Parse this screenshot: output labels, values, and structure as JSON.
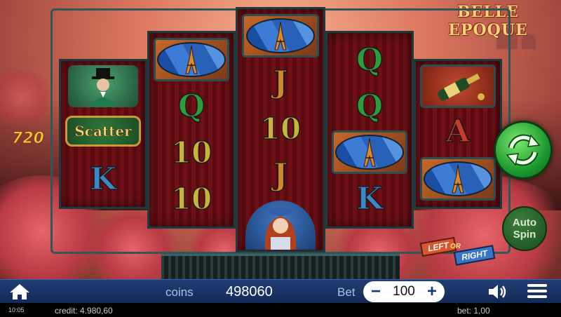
{
  "game": {
    "logo": "BELLE EPOQUE"
  },
  "last_win": "720",
  "reels": [
    [
      {
        "kind": "gentleman"
      },
      {
        "kind": "scatter",
        "text": "Scatter"
      },
      {
        "kind": "letter",
        "text": "K"
      }
    ],
    [
      {
        "kind": "eiffel"
      },
      {
        "kind": "letter",
        "text": "Q"
      },
      {
        "kind": "letter",
        "text": "10"
      },
      {
        "kind": "letter",
        "text": "10"
      }
    ],
    [
      {
        "kind": "eiffel"
      },
      {
        "kind": "letter",
        "text": "J"
      },
      {
        "kind": "letter",
        "text": "10"
      },
      {
        "kind": "letter",
        "text": "J"
      },
      {
        "kind": "lady"
      }
    ],
    [
      {
        "kind": "letter",
        "text": "Q"
      },
      {
        "kind": "letter",
        "text": "Q"
      },
      {
        "kind": "eiffel"
      },
      {
        "kind": "letter",
        "text": "K"
      }
    ],
    [
      {
        "kind": "champagne"
      },
      {
        "kind": "letter",
        "text": "A"
      },
      {
        "kind": "eiffel"
      }
    ]
  ],
  "controls": {
    "autospin_line1": "Auto",
    "autospin_line2": "Spin",
    "left_label": "LEFT",
    "or_label": "OR",
    "right_label": "RIGHT"
  },
  "toolbar": {
    "coins_label": "coins",
    "coins_value": "498060",
    "bet_label": "Bet",
    "bet_minus": "−",
    "bet_value": "100",
    "bet_plus": "+"
  },
  "status": {
    "time": "10:05",
    "credit": "credit: 4.980,60",
    "bet": "bet: 1,00"
  },
  "icons": {
    "home": "home-icon",
    "sound": "speaker-icon",
    "menu": "hamburger-menu-icon",
    "spin": "refresh-arrows-icon"
  },
  "colors": {
    "toolbar": "#1b3566",
    "spin_green": "#1d9b2f",
    "reel_red": "#6e1016",
    "frame_teal": "#2f5659"
  }
}
